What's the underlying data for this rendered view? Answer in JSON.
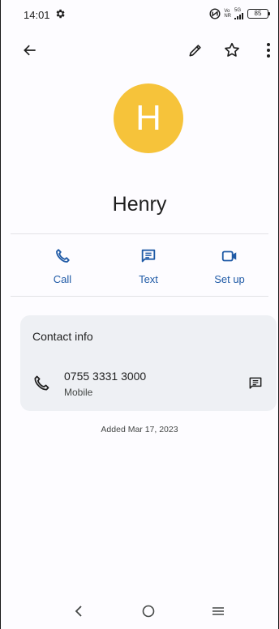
{
  "status_bar": {
    "time": "14:01",
    "network_top": "Vo",
    "network_bottom": "NR",
    "network_gen": "5G",
    "battery": "85"
  },
  "app_bar": {
    "icons": [
      "back-arrow-icon",
      "edit-pencil-icon",
      "star-outline-icon",
      "more-vert-icon"
    ]
  },
  "contact": {
    "initial": "H",
    "name": "Henry",
    "avatar_color": "#f6c33a"
  },
  "actions": [
    {
      "label": "Call",
      "icon": "phone-icon"
    },
    {
      "label": "Text",
      "icon": "message-icon"
    },
    {
      "label": "Set up",
      "icon": "video-call-icon"
    }
  ],
  "contact_info": {
    "title": "Contact info",
    "phone_number": "0755 3331 3000",
    "phone_type": "Mobile"
  },
  "added": "Added Mar 17, 2023",
  "colors": {
    "accent": "#1f5aa6",
    "card_bg": "#eef0f4"
  }
}
